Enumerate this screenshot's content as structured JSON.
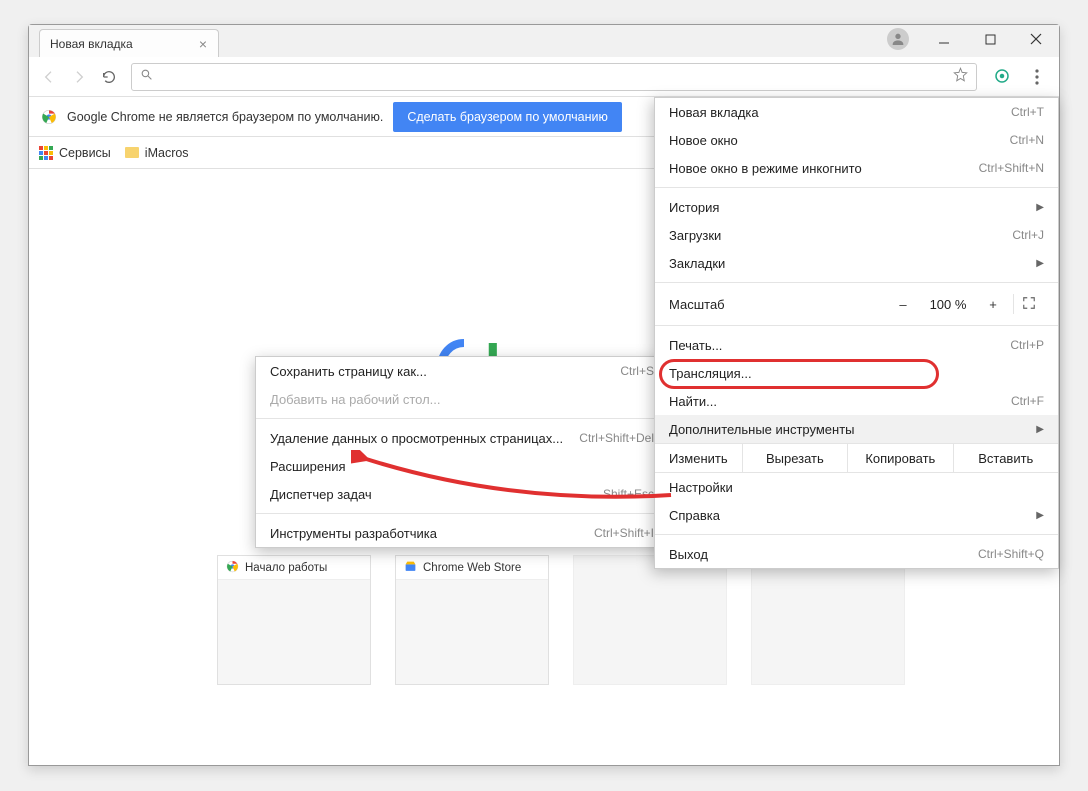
{
  "tab": {
    "title": "Новая вкладка"
  },
  "toolbar": {
    "omnibox_placeholder": ""
  },
  "infobar": {
    "text": "Google Chrome не является браузером по умолчанию.",
    "button": "Сделать браузером по умолчанию"
  },
  "bookmarks": {
    "apps": "Сервисы",
    "folder1": "iMacros"
  },
  "thumbs": [
    {
      "label": "Начало работы"
    },
    {
      "label": "Chrome Web Store"
    }
  ],
  "menu": {
    "new_tab": {
      "label": "Новая вкладка",
      "short": "Ctrl+T"
    },
    "new_window": {
      "label": "Новое окно",
      "short": "Ctrl+N"
    },
    "incognito": {
      "label": "Новое окно в режиме инкогнито",
      "short": "Ctrl+Shift+N"
    },
    "history": {
      "label": "История"
    },
    "downloads": {
      "label": "Загрузки",
      "short": "Ctrl+J"
    },
    "bookmarks": {
      "label": "Закладки"
    },
    "zoom": {
      "label": "Масштаб",
      "value": "100 %",
      "minus": "–",
      "plus": "+"
    },
    "print": {
      "label": "Печать...",
      "short": "Ctrl+P"
    },
    "cast": {
      "label": "Трансляция..."
    },
    "find": {
      "label": "Найти...",
      "short": "Ctrl+F"
    },
    "more_tools": {
      "label": "Дополнительные инструменты"
    },
    "edit": {
      "label": "Изменить",
      "cut": "Вырезать",
      "copy": "Копировать",
      "paste": "Вставить"
    },
    "settings": {
      "label": "Настройки"
    },
    "help": {
      "label": "Справка"
    },
    "exit": {
      "label": "Выход",
      "short": "Ctrl+Shift+Q"
    }
  },
  "submenu": {
    "save_as": {
      "label": "Сохранить страницу как...",
      "short": "Ctrl+S"
    },
    "add_desktop": {
      "label": "Добавить на рабочий стол..."
    },
    "clear_data": {
      "label": "Удаление данных о просмотренных страницах...",
      "short": "Ctrl+Shift+Del"
    },
    "extensions": {
      "label": "Расширения"
    },
    "task_mgr": {
      "label": "Диспетчер задач",
      "short": "Shift+Esc"
    },
    "dev_tools": {
      "label": "Инструменты разработчика",
      "short": "Ctrl+Shift+I"
    }
  }
}
